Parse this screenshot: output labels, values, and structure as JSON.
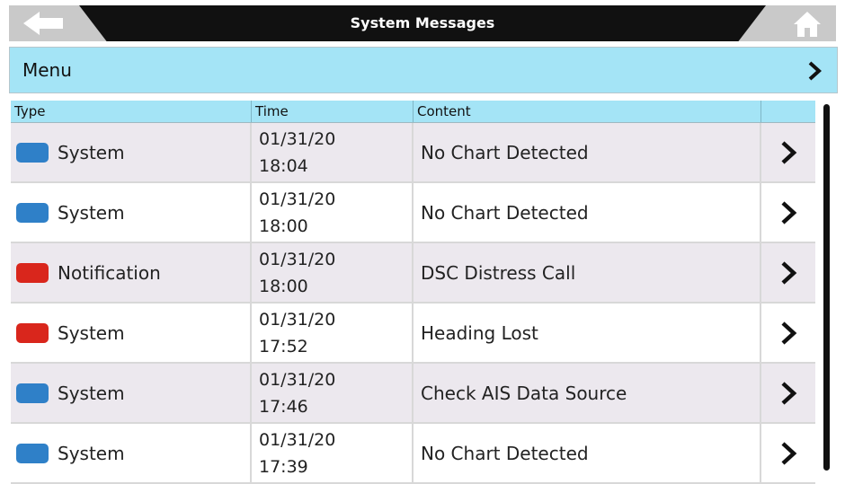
{
  "header": {
    "title": "System Messages",
    "back_icon": "back-arrow-icon",
    "home_icon": "home-icon"
  },
  "menu": {
    "label": "Menu",
    "icon": "chevron-right-icon"
  },
  "table": {
    "columns": [
      "Type",
      "Time",
      "Content",
      ""
    ],
    "rows": [
      {
        "type": "System",
        "color": "#2f80c8",
        "date": "01/31/20",
        "time": "18:04",
        "content": "No Chart Detected"
      },
      {
        "type": "System",
        "color": "#2f80c8",
        "date": "01/31/20",
        "time": "18:00",
        "content": "No Chart Detected"
      },
      {
        "type": "Notification",
        "color": "#d9261c",
        "date": "01/31/20",
        "time": "18:00",
        "content": "DSC Distress Call"
      },
      {
        "type": "System",
        "color": "#d9261c",
        "date": "01/31/20",
        "time": "17:52",
        "content": "Heading Lost"
      },
      {
        "type": "System",
        "color": "#2f80c8",
        "date": "01/31/20",
        "time": "17:46",
        "content": "Check AIS Data Source"
      },
      {
        "type": "System",
        "color": "#2f80c8",
        "date": "01/31/20",
        "time": "17:39",
        "content": "No Chart Detected"
      }
    ]
  },
  "colors": {
    "accent": "#a4e4f6",
    "title_bar": "#111111",
    "blue_status": "#2f80c8",
    "red_status": "#d9261c"
  }
}
